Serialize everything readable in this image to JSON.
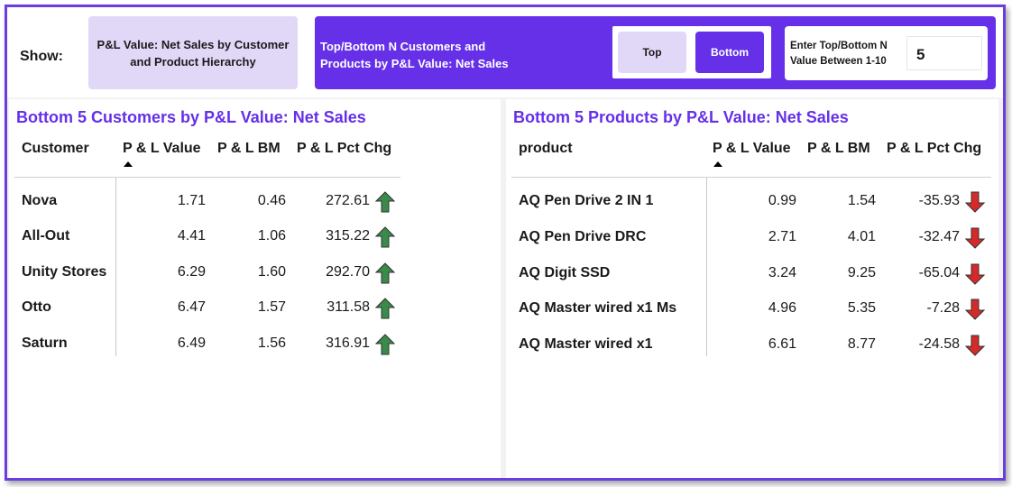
{
  "header": {
    "show_label": "Show:",
    "info_box": "P&L Value: Net Sales by Customer and Product Hierarchy",
    "panel_title": "Top/Bottom N Customers and Products by P&L Value: Net Sales",
    "toggle_top": "Top",
    "toggle_bottom": "Bottom",
    "toggle_selected": "Bottom",
    "n_label": "Enter Top/Bottom N Value Between 1-10",
    "n_value": "5"
  },
  "colors": {
    "accent": "#6530e8",
    "accent_light": "#e1d8f8",
    "up_arrow": "#3a8a4a",
    "down_arrow": "#d42a2a"
  },
  "customers": {
    "title": "Bottom 5 Customers by P&L Value: Net Sales",
    "columns": [
      "Customer",
      "P & L Value",
      "P & L BM",
      "P & L Pct Chg"
    ],
    "sorted_column": "P & L Value",
    "rows": [
      {
        "name": "Nova",
        "value": "1.71",
        "bm": "0.46",
        "pct": "272.61",
        "trend": "up-arrow-icon"
      },
      {
        "name": "All-Out",
        "value": "4.41",
        "bm": "1.06",
        "pct": "315.22",
        "trend": "up-arrow-icon"
      },
      {
        "name": "Unity Stores",
        "value": "6.29",
        "bm": "1.60",
        "pct": "292.70",
        "trend": "up-arrow-icon"
      },
      {
        "name": "Otto",
        "value": "6.47",
        "bm": "1.57",
        "pct": "311.58",
        "trend": "up-arrow-icon"
      },
      {
        "name": "Saturn",
        "value": "6.49",
        "bm": "1.56",
        "pct": "316.91",
        "trend": "up-arrow-icon"
      }
    ]
  },
  "products": {
    "title": "Bottom 5 Products by P&L Value: Net Sales",
    "columns": [
      "product",
      "P & L Value",
      "P & L BM",
      "P & L Pct Chg"
    ],
    "sorted_column": "P & L Value",
    "rows": [
      {
        "name": "AQ Pen Drive 2 IN 1",
        "value": "0.99",
        "bm": "1.54",
        "pct": "-35.93",
        "trend": "down-arrow-icon"
      },
      {
        "name": "AQ Pen Drive DRC",
        "value": "2.71",
        "bm": "4.01",
        "pct": "-32.47",
        "trend": "down-arrow-icon"
      },
      {
        "name": "AQ Digit SSD",
        "value": "3.24",
        "bm": "9.25",
        "pct": "-65.04",
        "trend": "down-arrow-icon"
      },
      {
        "name": "AQ Master wired x1 Ms",
        "value": "4.96",
        "bm": "5.35",
        "pct": "-7.28",
        "trend": "down-arrow-icon"
      },
      {
        "name": "AQ Master wired x1",
        "value": "6.61",
        "bm": "8.77",
        "pct": "-24.58",
        "trend": "down-arrow-icon"
      }
    ]
  }
}
